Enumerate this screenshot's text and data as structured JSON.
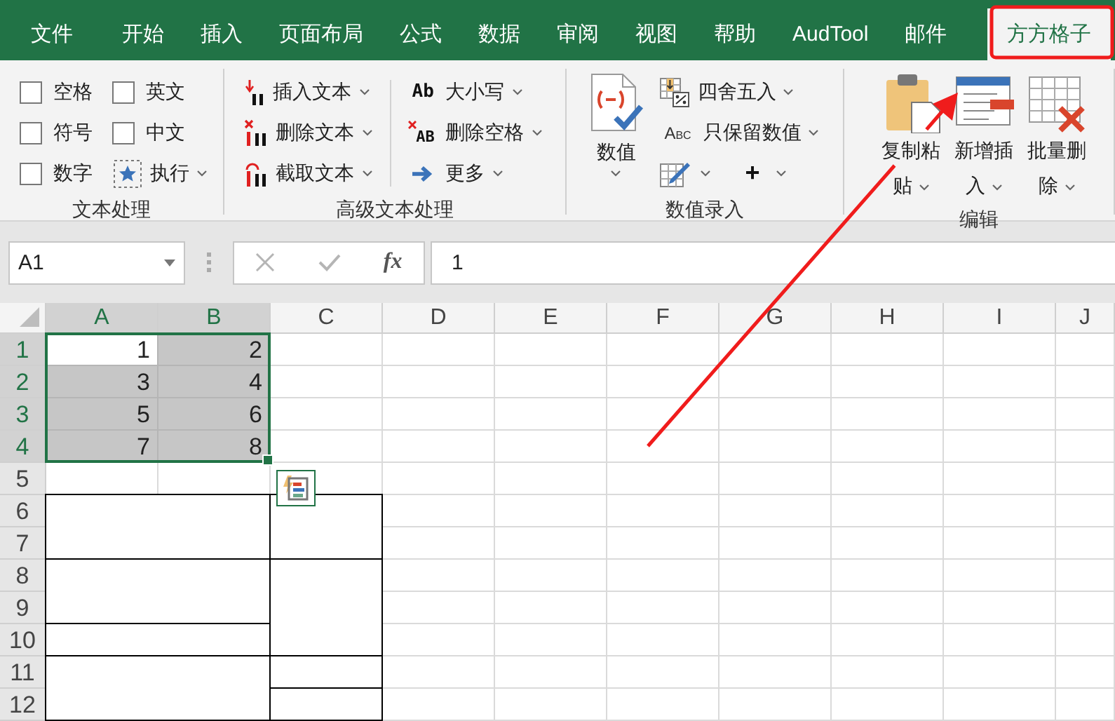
{
  "tabs": [
    {
      "label": "文件",
      "selected": false
    },
    {
      "label": "开始",
      "selected": false
    },
    {
      "label": "插入",
      "selected": false
    },
    {
      "label": "页面布局",
      "selected": false
    },
    {
      "label": "公式",
      "selected": false
    },
    {
      "label": "数据",
      "selected": false
    },
    {
      "label": "审阅",
      "selected": false
    },
    {
      "label": "视图",
      "selected": false
    },
    {
      "label": "帮助",
      "selected": false
    },
    {
      "label": "AudTool",
      "selected": false
    },
    {
      "label": "邮件",
      "selected": false
    },
    {
      "label": "方方格子",
      "selected": true
    }
  ],
  "ribbon": {
    "groups": [
      {
        "title": "文本处理",
        "kind": "checks",
        "items": [
          {
            "kind": "checkbox",
            "label": "空格",
            "checked": false
          },
          {
            "kind": "checkbox",
            "label": "符号",
            "checked": false
          },
          {
            "kind": "checkbox",
            "label": "数字",
            "checked": false
          },
          {
            "kind": "checkbox",
            "label": "英文",
            "checked": false
          },
          {
            "kind": "checkbox",
            "label": "中文",
            "checked": false
          },
          {
            "kind": "star",
            "label": "执行"
          }
        ]
      },
      {
        "title": "高级文本处理",
        "kind": "lists",
        "columns": [
          [
            {
              "kind": "insert",
              "label": "插入文本"
            },
            {
              "kind": "delete",
              "label": "删除文本"
            },
            {
              "kind": "extract",
              "label": "截取文本"
            }
          ],
          [
            {
              "kind": "case",
              "icon_text": "Ab",
              "label": "大小写"
            },
            {
              "kind": "spaces",
              "icon_text": "AB",
              "label": "删除空格"
            },
            {
              "kind": "more",
              "label": "更多"
            }
          ]
        ]
      },
      {
        "title": "数值录入",
        "kind": "numbers",
        "large": {
          "kind": "number",
          "label": "数值"
        },
        "items": [
          {
            "kind": "round",
            "label": "四舍五入"
          },
          {
            "kind": "abc",
            "icon_text": "Abc",
            "label": "只保留数值"
          }
        ],
        "tools": [
          {
            "kind": "edit"
          },
          {
            "kind": "plus",
            "label": "+"
          }
        ]
      },
      {
        "title": "编辑",
        "kind": "large",
        "items": [
          {
            "kind": "paste",
            "label": "复制粘贴"
          },
          {
            "kind": "insert-row",
            "label": "新增插入"
          },
          {
            "kind": "batch-delete",
            "label": "批量删除"
          }
        ]
      }
    ]
  },
  "formula_bar": {
    "name_box": "A1",
    "function_label": "fx",
    "formula": "1"
  },
  "sheet": {
    "columns": [
      {
        "label": "A",
        "selected": true
      },
      {
        "label": "B",
        "selected": true
      },
      {
        "label": "C",
        "selected": false
      },
      {
        "label": "D",
        "selected": false
      },
      {
        "label": "E",
        "selected": false
      },
      {
        "label": "F",
        "selected": false
      },
      {
        "label": "G",
        "selected": false
      },
      {
        "label": "H",
        "selected": false
      },
      {
        "label": "I",
        "selected": false
      },
      {
        "label": "J",
        "selected": false
      }
    ],
    "rows": [
      {
        "label": "1",
        "selected": true,
        "cells": [
          {
            "value": "1",
            "selected": true,
            "active": true
          },
          {
            "value": "2",
            "selected": true,
            "active": false
          }
        ]
      },
      {
        "label": "2",
        "selected": true,
        "cells": [
          {
            "value": "3",
            "selected": true,
            "active": false
          },
          {
            "value": "4",
            "selected": true,
            "active": false
          }
        ]
      },
      {
        "label": "3",
        "selected": true,
        "cells": [
          {
            "value": "5",
            "selected": true,
            "active": false
          },
          {
            "value": "6",
            "selected": true,
            "active": false
          }
        ]
      },
      {
        "label": "4",
        "selected": true,
        "cells": [
          {
            "value": "7",
            "selected": true,
            "active": false
          },
          {
            "value": "8",
            "selected": true,
            "active": false
          }
        ]
      },
      {
        "label": "5",
        "selected": false
      },
      {
        "label": "6",
        "selected": false
      },
      {
        "label": "7",
        "selected": false
      },
      {
        "label": "8",
        "selected": false
      },
      {
        "label": "9",
        "selected": false
      },
      {
        "label": "10",
        "selected": false
      },
      {
        "label": "11",
        "selected": false
      },
      {
        "label": "12",
        "selected": false
      }
    ]
  }
}
